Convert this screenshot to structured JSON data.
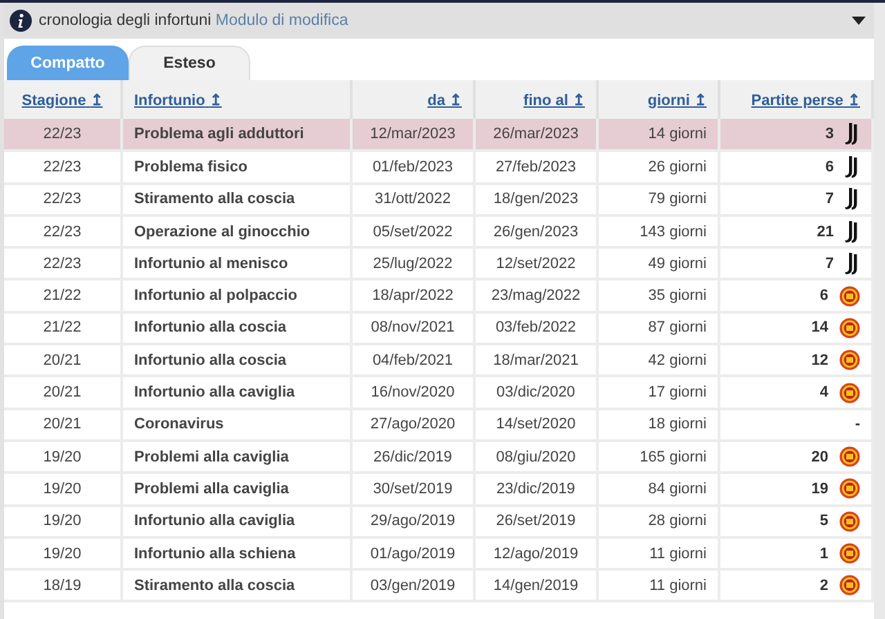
{
  "header": {
    "title": "cronologia degli infortuni",
    "link": "Modulo di modifica",
    "expanded": true
  },
  "tabs": [
    {
      "label": "Compatto",
      "selected": true
    },
    {
      "label": "Esteso",
      "selected": false
    }
  ],
  "table": {
    "columns": [
      {
        "label": "Stagione",
        "arrow": "↥"
      },
      {
        "label": "Infortunio",
        "arrow": "↥"
      },
      {
        "label": "da",
        "arrow": "↥"
      },
      {
        "label": "fino al",
        "arrow": "↥"
      },
      {
        "label": "giorni",
        "arrow": "↥"
      },
      {
        "label": "Partite perse",
        "arrow": "↥"
      }
    ],
    "rows": [
      {
        "season": "22/23",
        "injury": "Problema agli adduttori",
        "from": "12/mar/2023",
        "until": "26/mar/2023",
        "days": "14 giorni",
        "games": "3",
        "logo": {
          "kind": "stripes"
        },
        "selected": true
      },
      {
        "season": "22/23",
        "injury": "Problema fisico",
        "from": "01/feb/2023",
        "until": "27/feb/2023",
        "days": "26 giorni",
        "games": "6",
        "logo": {
          "kind": "stripes"
        },
        "selected": false
      },
      {
        "season": "22/23",
        "injury": "Stiramento alla coscia",
        "from": "31/ott/2022",
        "until": "18/gen/2023",
        "days": "79 giorni",
        "games": "7",
        "logo": {
          "kind": "stripes"
        },
        "selected": false
      },
      {
        "season": "22/23",
        "injury": "Operazione al ginocchio",
        "from": "05/set/2022",
        "until": "26/gen/2023",
        "days": "143 giorni",
        "games": "21",
        "logo": {
          "kind": "stripes"
        },
        "selected": false
      },
      {
        "season": "22/23",
        "injury": "Infortunio al menisco",
        "from": "25/lug/2022",
        "until": "12/set/2022",
        "days": "49 giorni",
        "games": "7",
        "logo": {
          "kind": "stripes"
        },
        "selected": false
      },
      {
        "season": "21/22",
        "injury": "Infortunio al polpaccio",
        "from": "18/apr/2022",
        "until": "23/mag/2022",
        "days": "35 giorni",
        "games": "6",
        "logo": {
          "kind": "crest"
        },
        "selected": false
      },
      {
        "season": "21/22",
        "injury": "Infortunio alla coscia",
        "from": "08/nov/2021",
        "until": "03/feb/2022",
        "days": "87 giorni",
        "games": "14",
        "logo": {
          "kind": "crest"
        },
        "selected": false
      },
      {
        "season": "20/21",
        "injury": "Infortunio alla coscia",
        "from": "04/feb/2021",
        "until": "18/mar/2021",
        "days": "42 giorni",
        "games": "12",
        "logo": {
          "kind": "crest"
        },
        "selected": false
      },
      {
        "season": "20/21",
        "injury": "Infortunio alla caviglia",
        "from": "16/nov/2020",
        "until": "03/dic/2020",
        "days": "17 giorni",
        "games": "4",
        "logo": {
          "kind": "crest"
        },
        "selected": false
      },
      {
        "season": "20/21",
        "injury": "Coronavirus",
        "from": "27/ago/2020",
        "until": "14/set/2020",
        "days": "18 giorni",
        "games": "-",
        "selected": false
      },
      {
        "season": "19/20",
        "injury": "Problemi alla caviglia",
        "from": "26/dic/2019",
        "until": "08/giu/2020",
        "days": "165 giorni",
        "games": "20",
        "logo": {
          "kind": "crest"
        },
        "selected": false
      },
      {
        "season": "19/20",
        "injury": "Problemi alla caviglia",
        "from": "30/set/2019",
        "until": "23/dic/2019",
        "days": "84 giorni",
        "games": "19",
        "logo": {
          "kind": "crest"
        },
        "selected": false
      },
      {
        "season": "19/20",
        "injury": "Infortunio alla caviglia",
        "from": "29/ago/2019",
        "until": "26/set/2019",
        "days": "28 giorni",
        "games": "5",
        "logo": {
          "kind": "crest"
        },
        "selected": false
      },
      {
        "season": "19/20",
        "injury": "Infortunio alla schiena",
        "from": "01/ago/2019",
        "until": "12/ago/2019",
        "days": "11 giorni",
        "games": "1",
        "logo": {
          "kind": "crest"
        },
        "selected": false
      },
      {
        "season": "18/19",
        "injury": "Stiramento alla coscia",
        "from": "03/gen/2019",
        "until": "14/gen/2019",
        "days": "11 giorni",
        "games": "2",
        "logo": {
          "kind": "crest"
        },
        "selected": false
      }
    ]
  }
}
